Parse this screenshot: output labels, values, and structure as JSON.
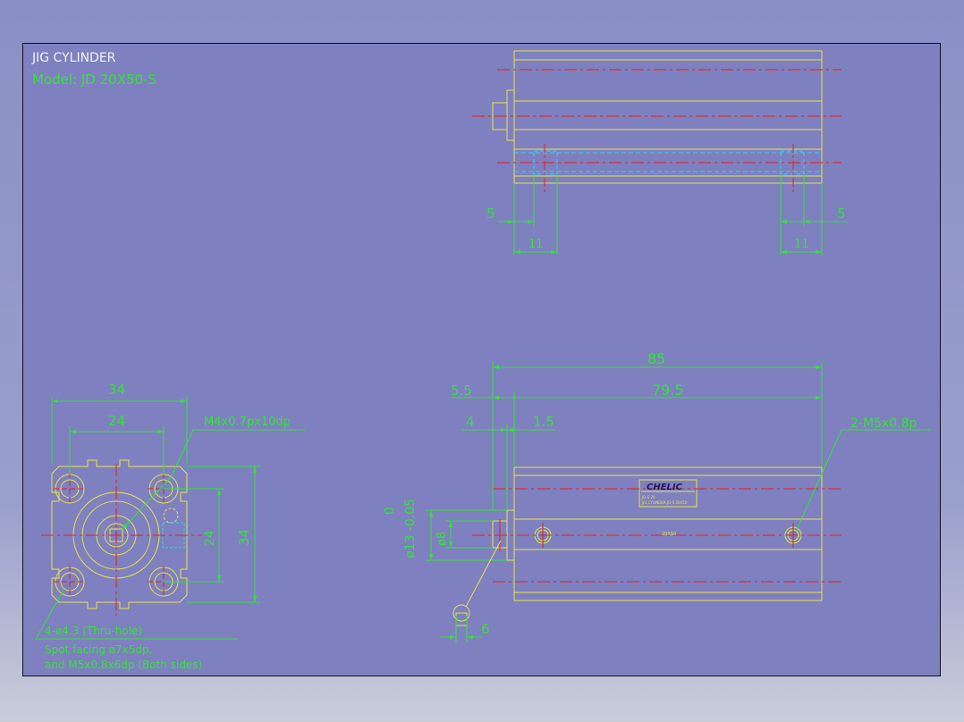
{
  "title": "JIG CYLINDER",
  "model": "Model:  JD 20X50-S",
  "colors": {
    "sheet_bg": "#7e80c0",
    "outline": "#e8e34a",
    "dimension": "#36e23a",
    "centerline": "#e02020",
    "hidden": "#33d4f0",
    "title_text": "#f2f2f2"
  },
  "top_view": {
    "dim_left_offset": "5",
    "dim_left_width": "11",
    "dim_right_offset": "5",
    "dim_right_width": "11"
  },
  "end_view": {
    "width": "34",
    "hole_pitch": "24",
    "thread_note": "M4x0.7px10dp",
    "height": "34",
    "hole_pitch_vertical": "24",
    "hole_note": "4-ø4.3 (Thru-hole)",
    "spot_note_1": "Spot facing ø7x5dp,",
    "spot_note_2": "and M5x0.8x6dp (Both sides)"
  },
  "side_view": {
    "overall_length": "85",
    "rod_extension": "5.5",
    "body_length": "79.5",
    "dim_4": "4",
    "dim_1_5": "1.5",
    "port_note": "2-M5x0.8p",
    "tolerance_upper": "0",
    "rod_boss_diameter": "ø13 -0.05",
    "rod_diameter": "ø8",
    "wrench_flat": "6",
    "label_brand": "CHELIC",
    "label_line_1": "JD-S 20",
    "label_line_2": "JIG CYLINDER JD-S 20X50",
    "mid_mark": "20X50"
  }
}
